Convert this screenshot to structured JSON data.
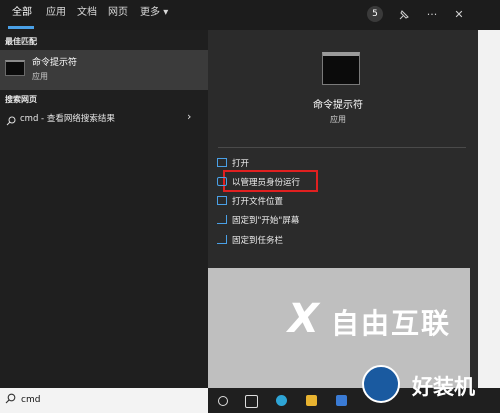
{
  "tabs": [
    {
      "label": "全部",
      "active": true
    },
    {
      "label": "应用"
    },
    {
      "label": "文档"
    },
    {
      "label": "网页"
    },
    {
      "label": "更多"
    }
  ],
  "more_arrow": "▾",
  "toolbar": {
    "badge": "5",
    "feedback_icon": "pin-feedback-icon",
    "more": "···",
    "close": "✕"
  },
  "left": {
    "best_match_header": "最佳匹配",
    "best_match": {
      "title": "命令提示符",
      "subtitle": "应用",
      "icon": "terminal-icon"
    },
    "web_header": "搜索网页",
    "web_item": {
      "query": "cmd",
      "suffix": " - 查看网络搜索结果",
      "chevron": "›"
    }
  },
  "right": {
    "title": "命令提示符",
    "subtitle": "应用",
    "actions": [
      {
        "label": "打开",
        "icon": "open-icon"
      },
      {
        "label": "以管理员身份运行",
        "icon": "admin-shield-icon",
        "highlighted": true
      },
      {
        "label": "打开文件位置",
        "icon": "folder-icon"
      },
      {
        "label": "固定到\"开始\"屏幕",
        "icon": "pin-icon"
      },
      {
        "label": "固定到任务栏",
        "icon": "pin-icon"
      }
    ]
  },
  "search": {
    "value": "cmd",
    "icon": "search-icon"
  },
  "watermark": {
    "x": "X",
    "text": "自由互联"
  },
  "logo": {
    "text": "好装机"
  },
  "colors": {
    "accent": "#4aa0e6",
    "highlight": "#e02020"
  }
}
